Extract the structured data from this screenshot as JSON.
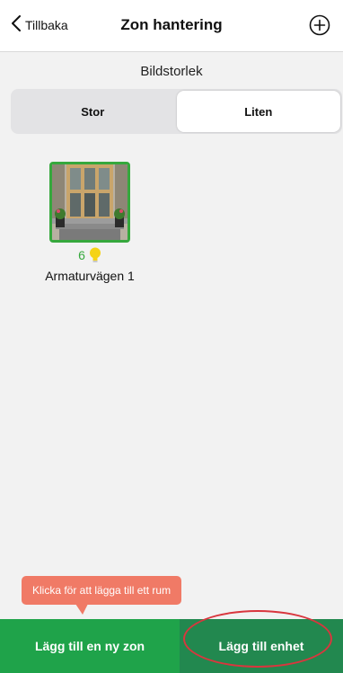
{
  "nav": {
    "back_label": "Tillbaka",
    "title": "Zon hantering",
    "add_icon": "plus-circle-icon"
  },
  "image_size": {
    "label": "Bildstorlek",
    "options": [
      "Stor",
      "Liten"
    ],
    "selected": "Liten"
  },
  "zones": [
    {
      "name": "Armaturvägen 1",
      "device_count": "6",
      "device_icon": "lightbulb-icon",
      "accent": "#36a83d"
    }
  ],
  "tooltip": {
    "text": "Klicka för att lägga till ett rum",
    "color": "#f07a66"
  },
  "bottom_bar": {
    "add_zone_label": "Lägg till en ny zon",
    "add_device_label": "Lägg till enhet",
    "add_zone_color": "#1fa34a",
    "add_device_color": "#22884f",
    "highlight_color": "#d9363e"
  }
}
